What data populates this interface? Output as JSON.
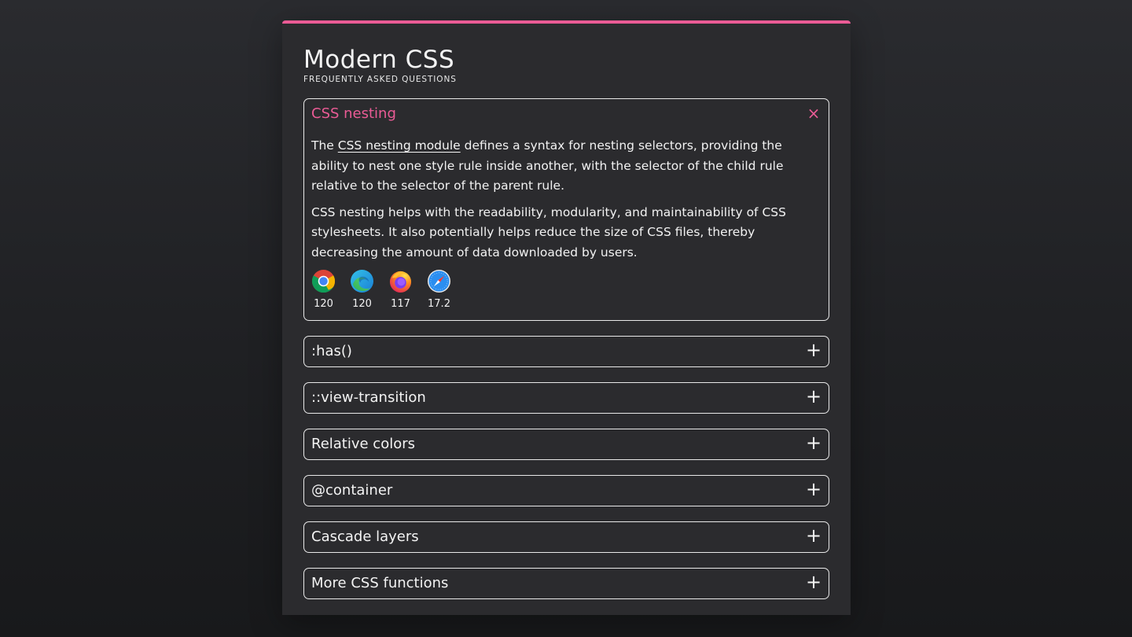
{
  "header": {
    "title": "Modern CSS",
    "subtitle": "FREQUENTLY ASKED QUESTIONS"
  },
  "colors": {
    "accent": "#ea5b95",
    "card_background": "#2b2b2e",
    "border": "#e9e9e9"
  },
  "faq": {
    "open_item": {
      "title": "CSS nesting",
      "toggle_icon": "close-icon",
      "toggle_symbol": "×",
      "paragraph1_before": "The ",
      "paragraph1_link": "CSS nesting module",
      "paragraph1_after": " defines a syntax for nesting selectors, providing the ability to nest one style rule inside another, with the selector of the child rule relative to the selector of the parent rule.",
      "paragraph2": "CSS nesting helps with the readability, modularity, and maintainability of CSS stylesheets. It also potentially helps reduce the size of CSS files, thereby decreasing the amount of data downloaded by users.",
      "browsers": [
        {
          "icon": "chrome-icon",
          "version": "120"
        },
        {
          "icon": "edge-icon",
          "version": "120"
        },
        {
          "icon": "firefox-icon",
          "version": "117"
        },
        {
          "icon": "safari-icon",
          "version": "17.2"
        }
      ]
    },
    "closed_items": [
      {
        "title": ":has()",
        "toggle_icon": "plus-icon",
        "toggle_symbol": "+"
      },
      {
        "title": "::view-transition",
        "toggle_icon": "plus-icon",
        "toggle_symbol": "+"
      },
      {
        "title": "Relative colors",
        "toggle_icon": "plus-icon",
        "toggle_symbol": "+"
      },
      {
        "title": "@container",
        "toggle_icon": "plus-icon",
        "toggle_symbol": "+"
      },
      {
        "title": "Cascade layers",
        "toggle_icon": "plus-icon",
        "toggle_symbol": "+"
      },
      {
        "title": "More CSS functions",
        "toggle_icon": "plus-icon",
        "toggle_symbol": "+"
      }
    ]
  }
}
